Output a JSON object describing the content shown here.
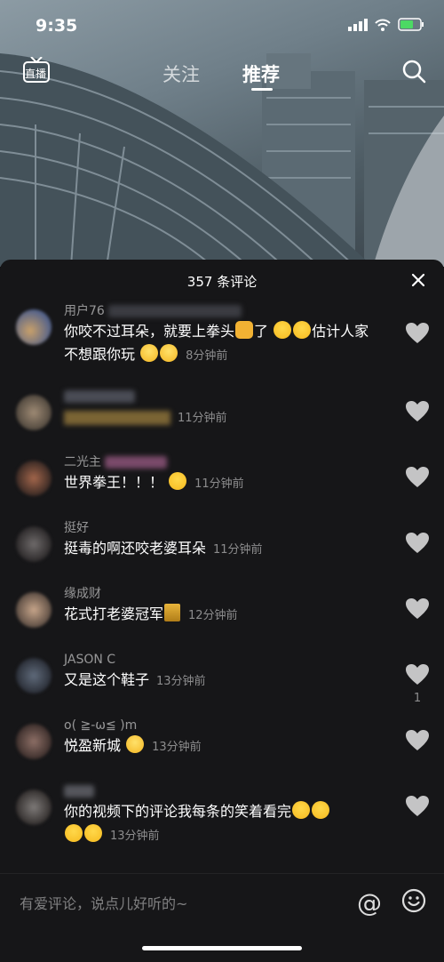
{
  "status_bar": {
    "time": "9:35"
  },
  "top_nav": {
    "live_label": "直播",
    "tabs": [
      {
        "label": "关注"
      },
      {
        "label": "推荐"
      }
    ]
  },
  "comments_sheet": {
    "title": "357 条评论",
    "comments": [
      {
        "username": "用户76",
        "text": "你咬不过耳朵，就要上拳头",
        "text2": "了",
        "text3": "估计人家不想跟你玩",
        "time": "8分钟前",
        "likes": ""
      },
      {
        "username": "",
        "text": "",
        "time": "11分钟前",
        "likes": ""
      },
      {
        "username": "二光主",
        "text": "世界拳王！！！",
        "time": "11分钟前",
        "likes": ""
      },
      {
        "username": "挺好",
        "text": "挺毒的啊还咬老婆耳朵",
        "time": "11分钟前",
        "likes": ""
      },
      {
        "username": "缘成财",
        "text": "花式打老婆冠军",
        "time": "12分钟前",
        "likes": ""
      },
      {
        "username": "JASON C",
        "text": "又是这个鞋子",
        "time": "13分钟前",
        "likes": "1"
      },
      {
        "username": "o( ≧-ω≦ )m",
        "text": "悦盈新城",
        "time": "13分钟前",
        "likes": ""
      },
      {
        "username": "",
        "text": "你的视频下的评论我每条的笑着看完",
        "time": "13分钟前",
        "likes": ""
      }
    ]
  },
  "input_bar": {
    "placeholder": "有爱评论，说点儿好听的~"
  },
  "icons": [
    "live-icon",
    "search-icon",
    "close-icon",
    "heart-icon",
    "at-icon",
    "emoji-icon"
  ]
}
